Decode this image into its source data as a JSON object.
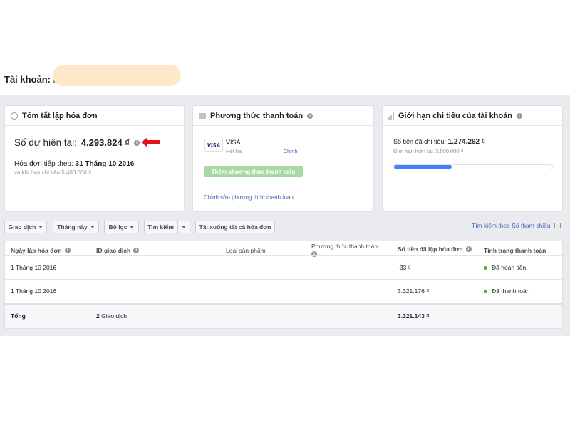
{
  "account": {
    "label": "Tài khoản:",
    "name": "l"
  },
  "summary_card": {
    "title": "Tóm tắt lập hóa đơn",
    "balance_label": "Số dư hiện tại:",
    "balance_value": "4.293.824 ₫",
    "next_invoice_label": "Hóa đơn tiếp theo:",
    "next_invoice_date": "31 Tháng 10 2016",
    "next_invoice_sub": "và khi bạn chi tiêu 5.400.000 ₫"
  },
  "payment_card": {
    "title": "Phương thức thanh toán",
    "card_logo": "VISA",
    "card_name": "VISA",
    "card_expiry": "Hết ha",
    "card_primary": "· Chính",
    "add_button": "Thêm phương thức thanh toán",
    "edit_link": "Chỉnh sửa phương thức thanh toán"
  },
  "limit_card": {
    "title": "Giới hạn chi tiêu của tài khoản",
    "spent_label": "Số tiền đã chi tiêu:",
    "spent_value": "1.274.292 ₫",
    "limit_label": "Giới hạn hiện tại: 3.500.000 ₫",
    "progress_fraction": 0.364
  },
  "toolbar": {
    "transactions": "Giao dịch",
    "this_month": "Tháng này",
    "filter": "Bộ lọc",
    "search": "Tìm kiếm",
    "download_all": "Tải xuống tất cả hóa đơn",
    "ref_search": "Tìm kiếm theo Số tham chiếu"
  },
  "table": {
    "headers": {
      "date": "Ngày lập hóa đơn",
      "txn_id": "ID giao dịch",
      "product": "Loại sản phẩm",
      "payment": "Phương thức thanh toán",
      "amount": "Số tiền đã lập hóa đơn",
      "status": "Tình trạng thanh toán"
    },
    "rows": [
      {
        "date": "1 Tháng 10 2016",
        "amount": "-33 ₫",
        "status": "Đã hoàn tiền"
      },
      {
        "date": "1 Tháng 10 2016",
        "amount": "3.321.176 ₫",
        "status": "Đã thanh toán"
      }
    ],
    "total": {
      "label": "Tổng",
      "count": "2",
      "count_label": "Giao dịch",
      "amount": "3.321.143 ₫"
    }
  },
  "colors": {
    "link": "#4267b2",
    "progress": "#4080ff",
    "add_button": "#a8d9a5",
    "status_green": "#42b72a",
    "arrow_red": "#e0121a"
  }
}
